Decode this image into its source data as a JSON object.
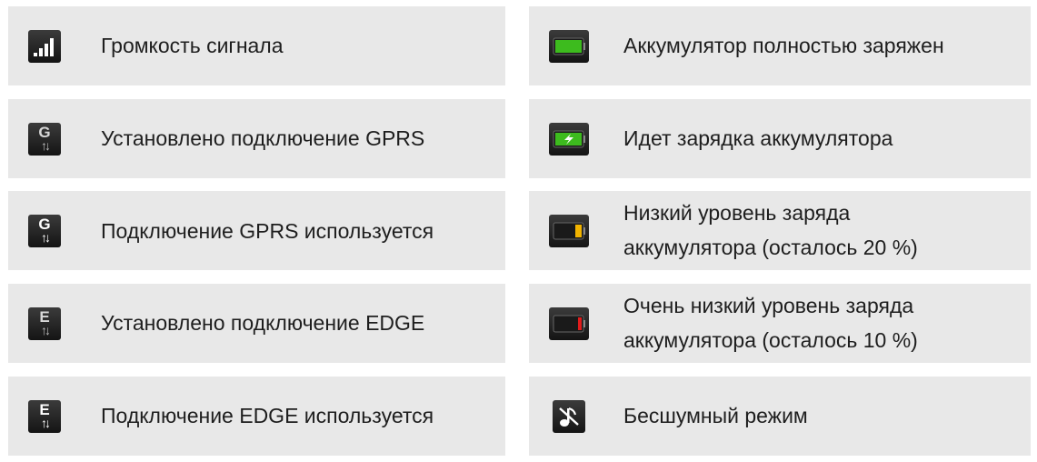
{
  "rows": [
    {
      "label": "Громкость сигнала",
      "icon": "signal-strength-icon"
    },
    {
      "label": "Установлено подключение GPRS",
      "icon": "gprs-connected-icon",
      "letter": "G"
    },
    {
      "label": "Подключение GPRS используется",
      "icon": "gprs-in-use-icon",
      "letter": "G"
    },
    {
      "label": "Установлено подключение EDGE",
      "icon": "edge-connected-icon",
      "letter": "E"
    },
    {
      "label": "Подключение EDGE используется",
      "icon": "edge-in-use-icon",
      "letter": "E"
    }
  ],
  "right_rows": [
    {
      "label_lines": [
        "Аккумулятор полностью заряжен"
      ],
      "icon": "battery-full-icon",
      "color": "#3dbb1e"
    },
    {
      "label_lines": [
        "Идет зарядка аккумулятора"
      ],
      "icon": "battery-charging-icon",
      "color": "#3dbb1e"
    },
    {
      "label_lines": [
        "Низкий уровень заряда",
        "аккумулятора (осталось 20 %)"
      ],
      "icon": "battery-low-icon",
      "color": "#f2b400"
    },
    {
      "label_lines": [
        "Очень низкий уровень заряда",
        "аккумулятора (осталось 10 %)"
      ],
      "icon": "battery-very-low-icon",
      "color": "#e01c1c"
    },
    {
      "label_lines": [
        "Бесшумный режим"
      ],
      "icon": "silent-mode-icon"
    }
  ],
  "arrows": "↑↓"
}
